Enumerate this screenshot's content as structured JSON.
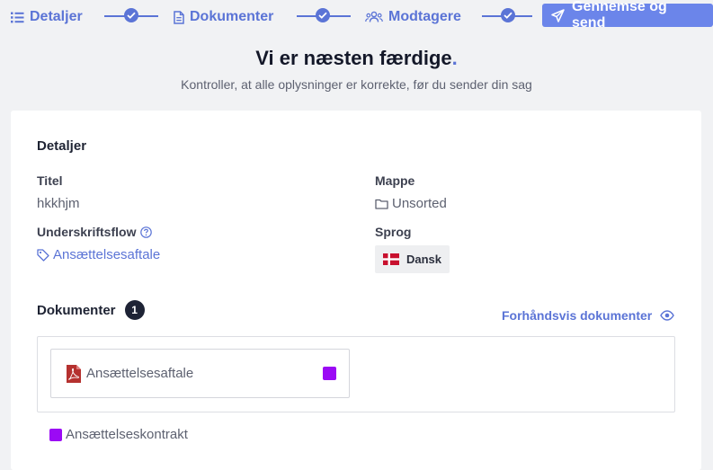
{
  "stepper": {
    "steps": [
      {
        "label": "Detaljer",
        "icon": "list-icon",
        "completed": true
      },
      {
        "label": "Dokumenter",
        "icon": "document-icon",
        "completed": true
      },
      {
        "label": "Modtagere",
        "icon": "users-icon",
        "completed": true
      },
      {
        "label": "Gennemse og send",
        "icon": "paper-plane-icon",
        "active": true
      }
    ]
  },
  "header": {
    "title": "Vi er næsten færdige",
    "title_dot": ".",
    "subtitle": "Kontroller, at alle oplysninger er korrekte, før du sender din sag"
  },
  "details": {
    "section_title": "Detaljer",
    "title_label": "Titel",
    "title_value": "hkkhjm",
    "folder_label": "Mappe",
    "folder_value": "Unsorted",
    "flow_label": "Underskriftsflow",
    "flow_value": "Ansættelsesaftale",
    "language_label": "Sprog",
    "language_value": "Dansk"
  },
  "documents": {
    "section_title": "Dokumenter",
    "count": "1",
    "preview_link": "Forhåndsvis dokumenter",
    "items": [
      {
        "name": "Ansættelsesaftale",
        "color": "#9b0af5"
      }
    ],
    "legend": [
      {
        "name": "Ansættelseskontrakt",
        "color": "#9b0af5"
      }
    ]
  },
  "colors": {
    "accent": "#5b74d6",
    "active_step": "#6b85ea",
    "document_tag": "#9b0af5",
    "pdf_icon": "#b5312f"
  }
}
